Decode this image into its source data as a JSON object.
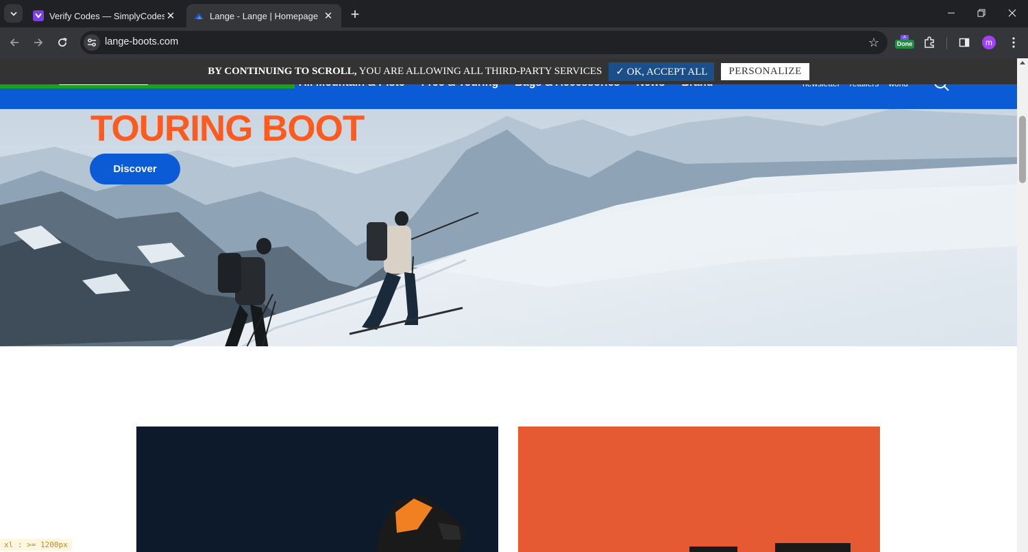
{
  "browser": {
    "tabs": [
      {
        "title": "Verify Codes — SimplyCodes",
        "active": false,
        "favicon": "simplycodes-icon"
      },
      {
        "title": "Lange - Lange | Homepage",
        "active": true,
        "favicon": "lange-icon"
      }
    ],
    "url": "lange-boots.com",
    "extension_badge_top": "A",
    "extension_badge": "Done",
    "profile_initial": "m"
  },
  "cookie_bar": {
    "text_bold": "BY CONTINUING TO SCROLL,",
    "text": " YOU ARE ALLOWING ALL THIRD-PARTY SERVICES",
    "accept_label": "✓ OK, ACCEPT ALL",
    "personalize_label": "PERSONALIZE"
  },
  "site_nav": {
    "main": [
      "All Mountain & Piste",
      "Free & Touring",
      "Bags & Accessories",
      "News",
      "Brand"
    ],
    "secondary": [
      "newsletter",
      "retailers",
      "world"
    ]
  },
  "hero": {
    "title": "TOURING BOOT",
    "cta": "Discover"
  },
  "debug_badge": "xl : >= 1200px",
  "colors": {
    "brand_blue": "#0b5bd7",
    "brand_orange": "#ff5a1f",
    "cookie_bg": "#333333",
    "accept_bg": "#1b4f8a"
  }
}
